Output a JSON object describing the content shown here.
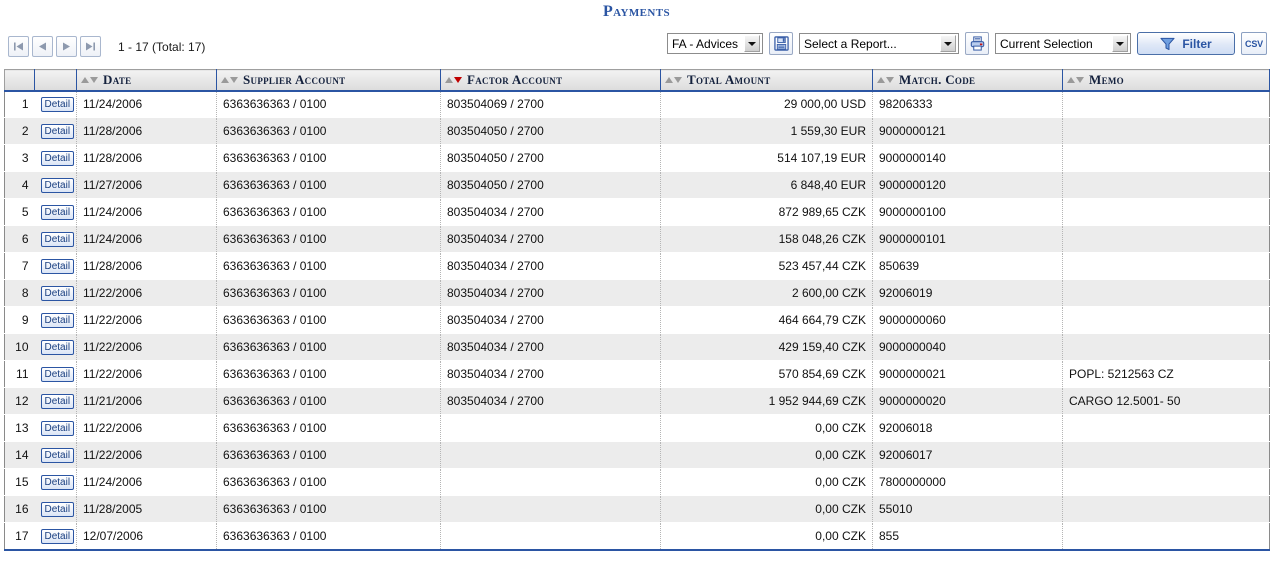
{
  "header": {
    "title": "Payments"
  },
  "toolbar": {
    "nav": {
      "first_label": "|<",
      "prev_label": "<",
      "next_label": ">",
      "last_label": ">|"
    },
    "pager_text": "1 - 17 (Total: 17)",
    "advices_select": {
      "value": "FA - Advices"
    },
    "save_icon": "floppy-disk-icon",
    "report_select": {
      "value": "Select a Report..."
    },
    "print_icon": "printer-icon",
    "selection_select": {
      "value": "Current Selection"
    },
    "filter_button": {
      "label": "Filter",
      "icon": "funnel-icon"
    },
    "csv_button": {
      "label": "CSV"
    },
    "accent_color": "#2b55a3"
  },
  "table": {
    "columns": [
      {
        "key": "num",
        "label": ""
      },
      {
        "key": "detail",
        "label": ""
      },
      {
        "key": "date",
        "label": "Date",
        "sort": "none"
      },
      {
        "key": "supplier",
        "label": "Supplier Account",
        "sort": "none"
      },
      {
        "key": "factor",
        "label": "Factor Account",
        "sort": "desc"
      },
      {
        "key": "amount",
        "label": "Total Amount",
        "sort": "none"
      },
      {
        "key": "match",
        "label": "Match. Code",
        "sort": "none"
      },
      {
        "key": "memo",
        "label": "Memo",
        "sort": "none"
      }
    ],
    "detail_label": "Detail",
    "rows": [
      {
        "num": "1",
        "date": "11/24/2006",
        "supplier": "6363636363 / 0100",
        "factor": "803504069 / 2700",
        "amount": "29 000,00 USD",
        "match": "98206333",
        "memo": ""
      },
      {
        "num": "2",
        "date": "11/28/2006",
        "supplier": "6363636363 / 0100",
        "factor": "803504050 / 2700",
        "amount": "1 559,30 EUR",
        "match": "9000000121",
        "memo": ""
      },
      {
        "num": "3",
        "date": "11/28/2006",
        "supplier": "6363636363 / 0100",
        "factor": "803504050 / 2700",
        "amount": "514 107,19 EUR",
        "match": "9000000140",
        "memo": ""
      },
      {
        "num": "4",
        "date": "11/27/2006",
        "supplier": "6363636363 / 0100",
        "factor": "803504050 / 2700",
        "amount": "6 848,40 EUR",
        "match": "9000000120",
        "memo": ""
      },
      {
        "num": "5",
        "date": "11/24/2006",
        "supplier": "6363636363 / 0100",
        "factor": "803504034 / 2700",
        "amount": "872 989,65 CZK",
        "match": "9000000100",
        "memo": ""
      },
      {
        "num": "6",
        "date": "11/24/2006",
        "supplier": "6363636363 / 0100",
        "factor": "803504034 / 2700",
        "amount": "158 048,26 CZK",
        "match": "9000000101",
        "memo": ""
      },
      {
        "num": "7",
        "date": "11/28/2006",
        "supplier": "6363636363 / 0100",
        "factor": "803504034 / 2700",
        "amount": "523 457,44 CZK",
        "match": "850639",
        "memo": ""
      },
      {
        "num": "8",
        "date": "11/22/2006",
        "supplier": "6363636363 / 0100",
        "factor": "803504034 / 2700",
        "amount": "2 600,00 CZK",
        "match": "92006019",
        "memo": ""
      },
      {
        "num": "9",
        "date": "11/22/2006",
        "supplier": "6363636363 / 0100",
        "factor": "803504034 / 2700",
        "amount": "464 664,79 CZK",
        "match": "9000000060",
        "memo": ""
      },
      {
        "num": "10",
        "date": "11/22/2006",
        "supplier": "6363636363 / 0100",
        "factor": "803504034 / 2700",
        "amount": "429 159,40 CZK",
        "match": "9000000040",
        "memo": ""
      },
      {
        "num": "11",
        "date": "11/22/2006",
        "supplier": "6363636363 / 0100",
        "factor": "803504034 / 2700",
        "amount": "570 854,69 CZK",
        "match": "9000000021",
        "memo": "POPL: 5212563 CZ"
      },
      {
        "num": "12",
        "date": "11/21/2006",
        "supplier": "6363636363 / 0100",
        "factor": "803504034 / 2700",
        "amount": "1 952 944,69 CZK",
        "match": "9000000020",
        "memo": "CARGO 12.5001- 50"
      },
      {
        "num": "13",
        "date": "11/22/2006",
        "supplier": "6363636363 / 0100",
        "factor": "",
        "amount": "0,00 CZK",
        "match": "92006018",
        "memo": ""
      },
      {
        "num": "14",
        "date": "11/22/2006",
        "supplier": "6363636363 / 0100",
        "factor": "",
        "amount": "0,00 CZK",
        "match": "92006017",
        "memo": ""
      },
      {
        "num": "15",
        "date": "11/24/2006",
        "supplier": "6363636363 / 0100",
        "factor": "",
        "amount": "0,00 CZK",
        "match": "7800000000",
        "memo": ""
      },
      {
        "num": "16",
        "date": "11/28/2005",
        "supplier": "6363636363 / 0100",
        "factor": "",
        "amount": "0,00 CZK",
        "match": "55010",
        "memo": ""
      },
      {
        "num": "17",
        "date": "12/07/2006",
        "supplier": "6363636363 / 0100",
        "factor": "",
        "amount": "0,00 CZK",
        "match": "855",
        "memo": ""
      }
    ]
  }
}
